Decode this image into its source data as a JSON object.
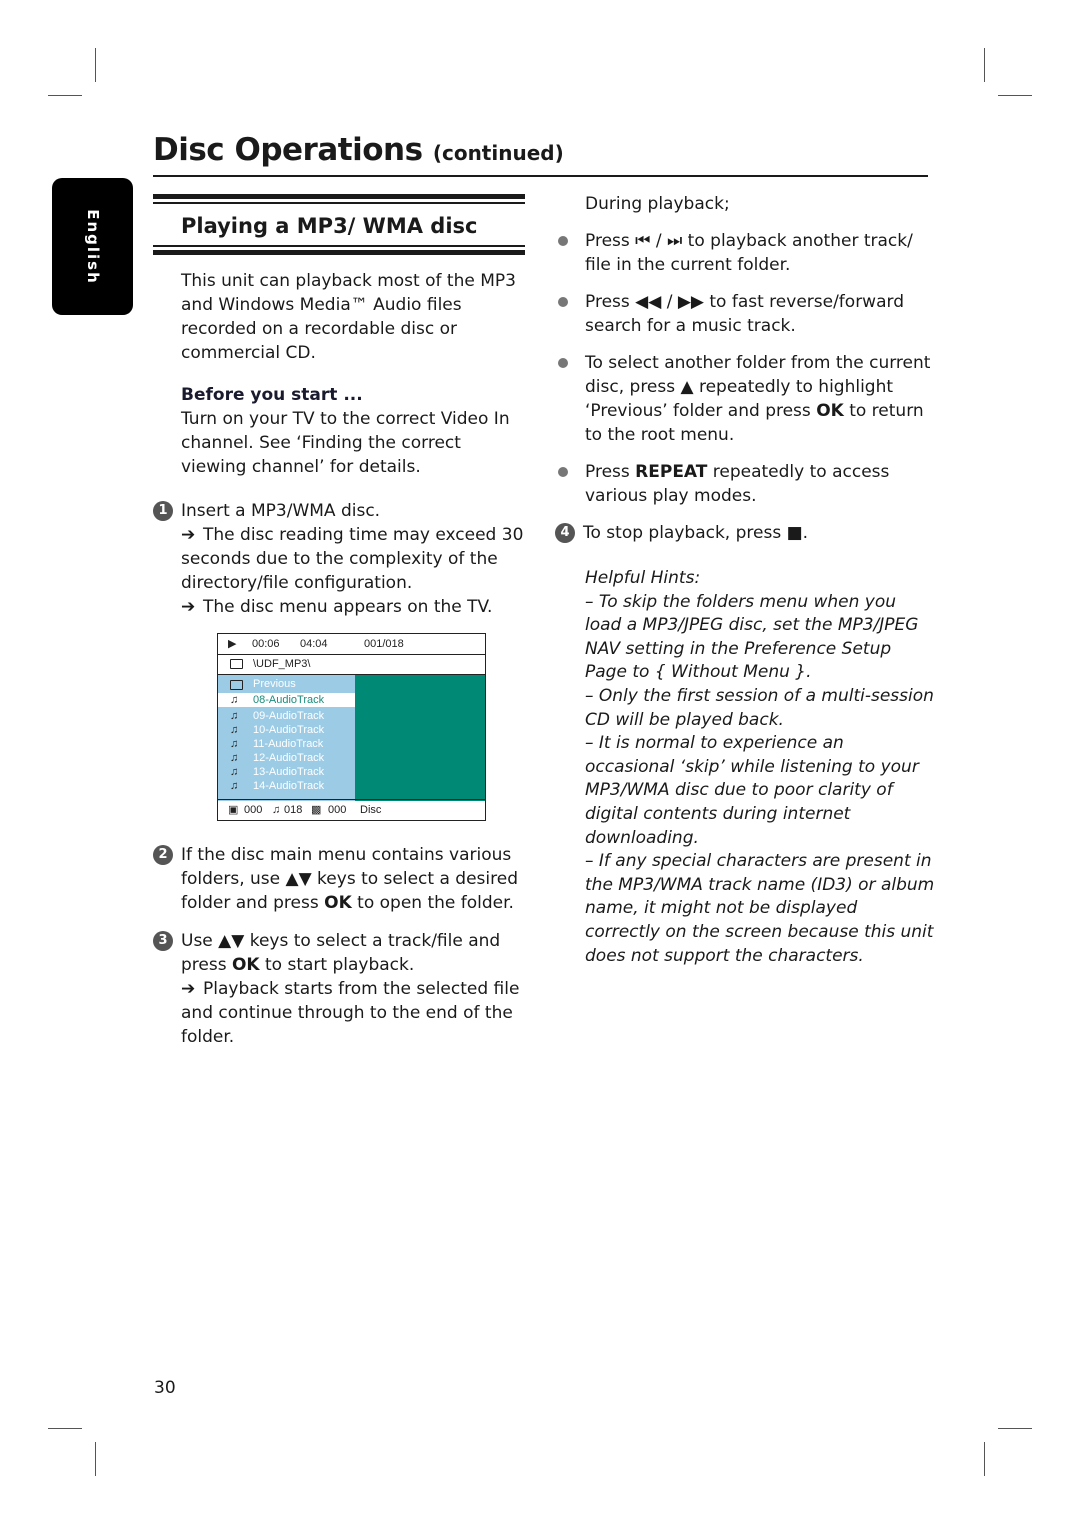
{
  "page": {
    "title": "Disc Operations",
    "title_suffix": "(continued)",
    "language_tab": "English",
    "page_number": "30"
  },
  "section": {
    "title": "Playing a MP3/ WMA disc",
    "intro": "This unit can playback most of the MP3 and Windows Media™ Audio files recorded on a recordable disc or commercial CD.",
    "before_heading": "Before you start ...",
    "before_text": "Turn on your TV to the correct Video In channel. See ‘Finding the correct viewing channel’ for details."
  },
  "steps": [
    {
      "num": "1",
      "text": "Insert a MP3/WMA disc.",
      "results": [
        "The disc reading time may exceed 30 seconds due to the complexity of the directory/file configuration.",
        "The disc menu appears on the TV."
      ]
    },
    {
      "num": "2",
      "pre": "If the disc main menu contains various folders, use ▲▼ keys to select a desired folder and press ",
      "bold": "OK",
      "post": " to open the folder."
    },
    {
      "num": "3",
      "pre": "Use ▲▼ keys to select a track/file and press ",
      "bold": "OK",
      "post": " to start playback.",
      "result": "Playback starts from the selected file and continue through to the end of the folder."
    },
    {
      "num": "4",
      "text": "To stop playback, press ■."
    }
  ],
  "arrow_glyph": "➔",
  "osd": {
    "play_icon": "▶",
    "elapsed": "00:06",
    "total": "04:04",
    "track_count": "001/018",
    "path": "\\UDF_MP3\\",
    "items": [
      {
        "icon": "folder",
        "label": "Previous",
        "selected": false
      },
      {
        "icon": "music-note",
        "label": "08-AudioTrack",
        "selected": true
      },
      {
        "icon": "music-note",
        "label": "09-AudioTrack",
        "selected": false
      },
      {
        "icon": "music-note",
        "label": "10-AudioTrack",
        "selected": false
      },
      {
        "icon": "music-note",
        "label": "11-AudioTrack",
        "selected": false
      },
      {
        "icon": "music-note",
        "label": "12-AudioTrack",
        "selected": false
      },
      {
        "icon": "music-note",
        "label": "13-AudioTrack",
        "selected": false
      },
      {
        "icon": "music-note",
        "label": "14-AudioTrack",
        "selected": false
      }
    ],
    "footer": {
      "photo_count": "000",
      "audio_count": "018",
      "video_count": "000",
      "source": "Disc"
    },
    "colors": {
      "list_bg": "#9ccbe6",
      "preview_bg": "#008a76",
      "selected_text": "#1a8c7c"
    }
  },
  "right": {
    "during": "During playback;",
    "bullets": [
      {
        "pre": "Press ⏮ / ⏭ to playback another track/ file in the current folder."
      },
      {
        "pre": "Press ◀◀ / ▶▶ to fast reverse/forward search for a music track."
      },
      {
        "pre": "To select another folder from the current disc, press ▲ repeatedly to highlight ‘Previous’ folder and press ",
        "bold": "OK",
        "post": " to return to the root menu."
      },
      {
        "pre": "Press ",
        "bold": "REPEAT",
        "post": " repeatedly to access various play modes."
      }
    ],
    "hints_title": "Helpful Hints:",
    "hints": [
      "–  To skip the folders menu when you load a MP3/JPEG disc, set the MP3/JPEG NAV setting in the Preference Setup Page to { Without Menu }.",
      "–  Only the first session of a multi-session CD will be played back.",
      "–  It is normal to experience an occasional ‘skip’ while listening to your MP3/WMA disc due to poor clarity of digital contents during internet downloading.",
      "–  If any special characters are present in the MP3/WMA track name (ID3) or album name, it might not be displayed correctly on the screen because this unit does not support the characters."
    ]
  }
}
